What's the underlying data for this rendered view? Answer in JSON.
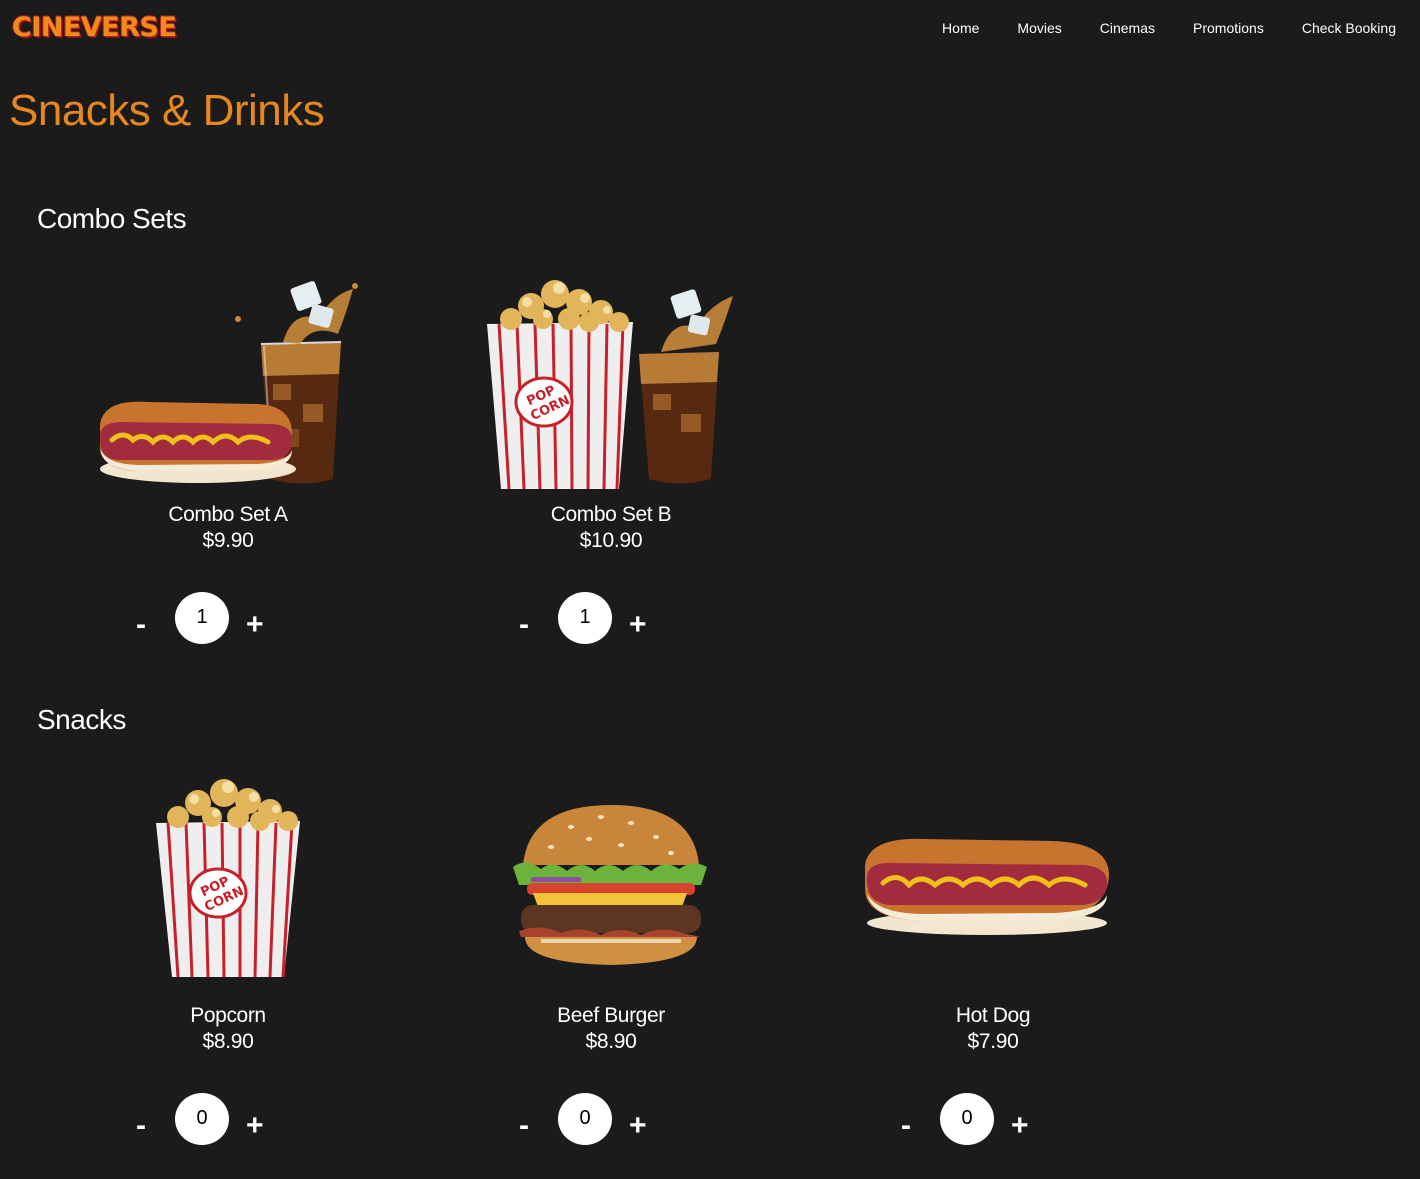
{
  "brand": {
    "logo_text": "CINEVERSE"
  },
  "nav": [
    "Home",
    "Movies",
    "Cinemas",
    "Promotions",
    "Check Booking"
  ],
  "page_title": "Snacks & Drinks",
  "sections": [
    {
      "title": "Combo Sets",
      "items": [
        {
          "name": "Combo Set A",
          "price": "$9.90",
          "quantity": "1",
          "image": "hotdog-and-cola"
        },
        {
          "name": "Combo Set B",
          "price": "$10.90",
          "quantity": "1",
          "image": "popcorn-and-cola"
        }
      ]
    },
    {
      "title": "Snacks",
      "items": [
        {
          "name": "Popcorn",
          "price": "$8.90",
          "quantity": "0",
          "image": "popcorn-box"
        },
        {
          "name": "Beef Burger",
          "price": "$8.90",
          "quantity": "0",
          "image": "beef-burger"
        },
        {
          "name": "Hot Dog",
          "price": "$7.90",
          "quantity": "0",
          "image": "hot-dog"
        }
      ]
    }
  ],
  "controls": {
    "minus": "-",
    "plus": "+"
  },
  "popcorn_label": "POP CORN"
}
